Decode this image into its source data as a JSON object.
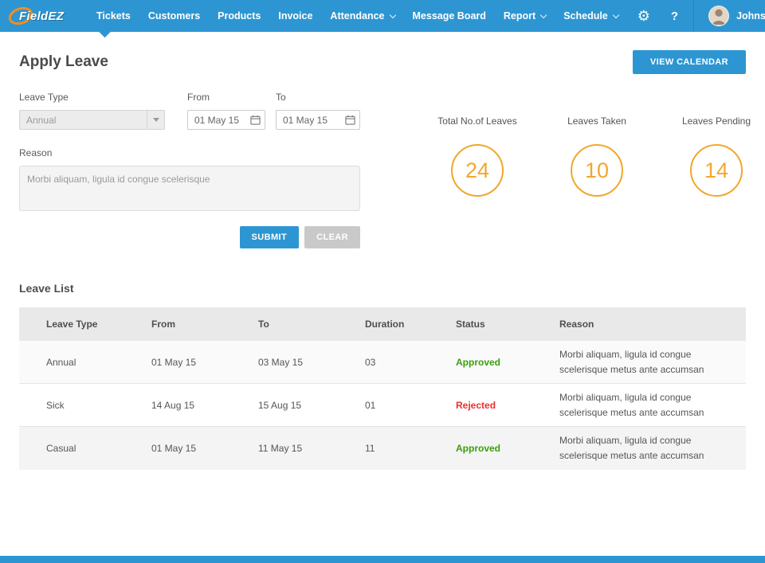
{
  "navbar": {
    "brand": "FieldEZ",
    "items": [
      {
        "label": "Tickets"
      },
      {
        "label": "Customers"
      },
      {
        "label": "Products"
      },
      {
        "label": "Invoice"
      },
      {
        "label": "Attendance"
      },
      {
        "label": "Message Board"
      },
      {
        "label": "Report"
      },
      {
        "label": "Schedule"
      }
    ],
    "gear_icon": "⚙",
    "help_label": "?",
    "user_name": "Johnson"
  },
  "page": {
    "title": "Apply Leave",
    "view_calendar_label": "VIEW CALENDAR"
  },
  "form": {
    "leave_type_label": "Leave Type",
    "leave_type_value": "Annual",
    "from_label": "From",
    "from_value": "01 May 15",
    "to_label": "To",
    "to_value": "01 May 15",
    "reason_label": "Reason",
    "reason_value": "Morbi aliquam, ligula id congue scelerisque",
    "submit_label": "SUBMIT",
    "clear_label": "CLEAR"
  },
  "stats": [
    {
      "label": "Total No.of Leaves",
      "value": "24"
    },
    {
      "label": "Leaves Taken",
      "value": "10"
    },
    {
      "label": "Leaves Pending",
      "value": "14"
    }
  ],
  "leave_list": {
    "title": "Leave List",
    "columns": [
      "Leave Type",
      "From",
      "To",
      "Duration",
      "Status",
      "Reason"
    ],
    "rows": [
      {
        "leave_type": "Annual",
        "from": "01 May 15",
        "to": "03 May 15",
        "duration": "03",
        "status": "Approved",
        "status_class": "status approved",
        "reason": "Morbi aliquam, ligula id congue scelerisque metus ante accumsan"
      },
      {
        "leave_type": "Sick",
        "from": "14 Aug 15",
        "to": "15 Aug 15",
        "duration": "01",
        "status": "Rejected",
        "status_class": "status rejected",
        "reason": "Morbi aliquam, ligula id congue scelerisque metus ante accumsan"
      },
      {
        "leave_type": "Casual",
        "from": "01 May 15",
        "to": "11 May 15",
        "duration": "11",
        "status": "Approved",
        "status_class": "status approved",
        "reason": "Morbi aliquam, ligula id congue scelerisque metus ante accumsan"
      }
    ]
  },
  "colors": {
    "navbar_blue": "#2d96d2",
    "ring_orange": "#f2a72c",
    "approved_green": "#3aa00a",
    "rejected_red": "#e9302a",
    "clear_grey": "#c9c9c9"
  }
}
